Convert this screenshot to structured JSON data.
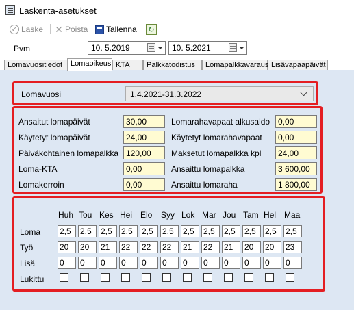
{
  "window": {
    "title": "Laskenta-asetukset"
  },
  "toolbar": {
    "laske_label": "Laske",
    "poista_label": "Poista",
    "tallenna_label": "Tallenna"
  },
  "dates": {
    "label": "Pvm",
    "start": "10.  5.2019",
    "end": "10.  5.2021"
  },
  "tabs": [
    {
      "label": "Lomavuositiedot",
      "active": false
    },
    {
      "label": "Lomaoikeus",
      "active": true
    },
    {
      "label": "KTA",
      "active": false
    },
    {
      "label": "Palkkatodistus",
      "active": false
    },
    {
      "label": "Lomapalkkavaraus",
      "active": false
    },
    {
      "label": "Lisävapaapäivät",
      "active": false
    }
  ],
  "lomavuosi": {
    "label": "Lomavuosi",
    "value": "1.4.2021-31.3.2022"
  },
  "fields": {
    "ansaitut_lomapaivat": {
      "label": "Ansaitut lomapäivät",
      "value": "30,00"
    },
    "kaytetyt_lomapaivat": {
      "label": "Käytetyt lomapäivät",
      "value": "24,00"
    },
    "paivakohtainen_lomapalkka": {
      "label": "Päiväkohtainen lomapalkka",
      "value": "120,00"
    },
    "loma_kta": {
      "label": "Loma-KTA",
      "value": "0,00"
    },
    "lomakerroin": {
      "label": "Lomakerroin",
      "value": "0,00"
    },
    "lomarahavapaat_alkusaldo": {
      "label": "Lomarahavapaat alkusaldo",
      "value": "0,00"
    },
    "kaytetyt_lomarahavapaat": {
      "label": "Käytetyt lomarahavapaat",
      "value": "0,00"
    },
    "maksetut_lomapalkka_kpl": {
      "label": "Maksetut lomapalkka kpl",
      "value": "24,00"
    },
    "ansaittu_lomapalkka": {
      "label": "Ansaittu lomapalkka",
      "value": "3 600,00"
    },
    "ansaittu_lomaraha": {
      "label": "Ansaittu lomaraha",
      "value": "1 800,00"
    }
  },
  "months": {
    "headers": [
      "Huh",
      "Tou",
      "Kes",
      "Hei",
      "Elo",
      "Syy",
      "Lok",
      "Mar",
      "Jou",
      "Tam",
      "Hel",
      "Maa"
    ],
    "row_labels": {
      "loma": "Loma",
      "tyo": "Työ",
      "lisa": "Lisä",
      "lukittu": "Lukittu"
    },
    "loma": [
      "2,5",
      "2,5",
      "2,5",
      "2,5",
      "2,5",
      "2,5",
      "2,5",
      "2,5",
      "2,5",
      "2,5",
      "2,5",
      "2,5"
    ],
    "tyo": [
      "20",
      "20",
      "21",
      "22",
      "22",
      "22",
      "21",
      "22",
      "21",
      "20",
      "20",
      "23"
    ],
    "lisa": [
      "0",
      "0",
      "0",
      "0",
      "0",
      "0",
      "0",
      "0",
      "0",
      "0",
      "0",
      "0"
    ],
    "lukittu": [
      false,
      false,
      false,
      false,
      false,
      false,
      false,
      false,
      false,
      false,
      false,
      false
    ]
  },
  "colors": {
    "highlight_border": "#e41e22",
    "field_yellow": "#fffbd2",
    "panel_blue": "#dde7f3"
  }
}
